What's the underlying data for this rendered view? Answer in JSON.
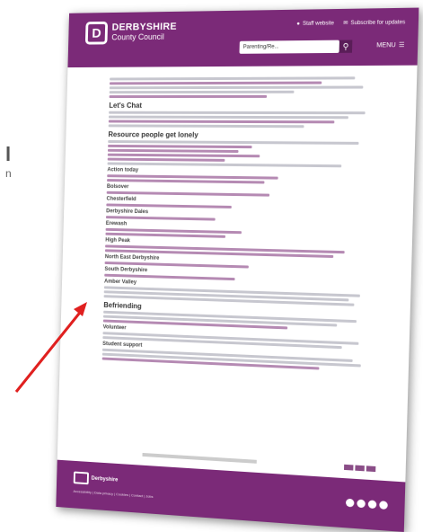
{
  "side_text": {
    "title": "l",
    "subtitle": "n"
  },
  "header": {
    "logo_mark": "D",
    "logo_line1": "DERBYSHIRE",
    "logo_line2": "County Council",
    "staff_link": "Staff website",
    "subscribe_link": "Subscribe for updates",
    "search_value": "Parenting/Re...",
    "menu_label": "MENU"
  },
  "content": {
    "headings": [
      "Let's Chat",
      "Resource people get lonely",
      "Befriending"
    ],
    "subheadings": [
      "Action today",
      "Bolsover",
      "Chesterfield",
      "Derbyshire Dales",
      "Erewash",
      "High Peak",
      "North East Derbyshire",
      "South Derbyshire",
      "Amber Valley",
      "Volunteer",
      "Student support"
    ]
  },
  "footer": {
    "logo_text": "Derbyshire",
    "links": "Accessibility | Data privacy | Cookies | Contact | Jobs"
  },
  "colors": {
    "brand": "#7b2a78",
    "arrow": "#e0201f"
  }
}
